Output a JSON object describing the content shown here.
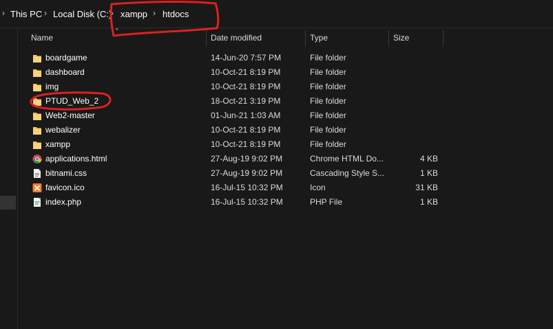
{
  "breadcrumb": {
    "items": [
      "This PC",
      "Local Disk (C:)",
      "xampp",
      "htdocs"
    ],
    "separator": "›"
  },
  "columns": [
    "Name",
    "Date modified",
    "Type",
    "Size"
  ],
  "files": [
    {
      "name": "boardgame",
      "date": "14-Jun-20 7:57 PM",
      "type": "File folder",
      "size": "",
      "icon": "folder-icon"
    },
    {
      "name": "dashboard",
      "date": "10-Oct-21 8:19 PM",
      "type": "File folder",
      "size": "",
      "icon": "folder-icon"
    },
    {
      "name": "img",
      "date": "10-Oct-21 8:19 PM",
      "type": "File folder",
      "size": "",
      "icon": "folder-icon"
    },
    {
      "name": "PTUD_Web_2",
      "date": "18-Oct-21 3:19 PM",
      "type": "File folder",
      "size": "",
      "icon": "folder-icon"
    },
    {
      "name": "Web2-master",
      "date": "01-Jun-21 1:03 AM",
      "type": "File folder",
      "size": "",
      "icon": "folder-icon"
    },
    {
      "name": "webalizer",
      "date": "10-Oct-21 8:19 PM",
      "type": "File folder",
      "size": "",
      "icon": "folder-icon"
    },
    {
      "name": "xampp",
      "date": "10-Oct-21 8:19 PM",
      "type": "File folder",
      "size": "",
      "icon": "folder-icon"
    },
    {
      "name": "applications.html",
      "date": "27-Aug-19 9:02 PM",
      "type": "Chrome HTML Do...",
      "size": "4 KB",
      "icon": "chrome-icon"
    },
    {
      "name": "bitnami.css",
      "date": "27-Aug-19 9:02 PM",
      "type": "Cascading Style S...",
      "size": "1 KB",
      "icon": "css-file-icon"
    },
    {
      "name": "favicon.ico",
      "date": "16-Jul-15 10:32 PM",
      "type": "Icon",
      "size": "31 KB",
      "icon": "xampp-icon"
    },
    {
      "name": "index.php",
      "date": "16-Jul-15 10:32 PM",
      "type": "PHP File",
      "size": "1 KB",
      "icon": "php-file-icon"
    }
  ],
  "colors": {
    "background": "#191919",
    "text": "#dcdcdc",
    "folder": "#f2c55c",
    "annotation": "#e02020"
  }
}
